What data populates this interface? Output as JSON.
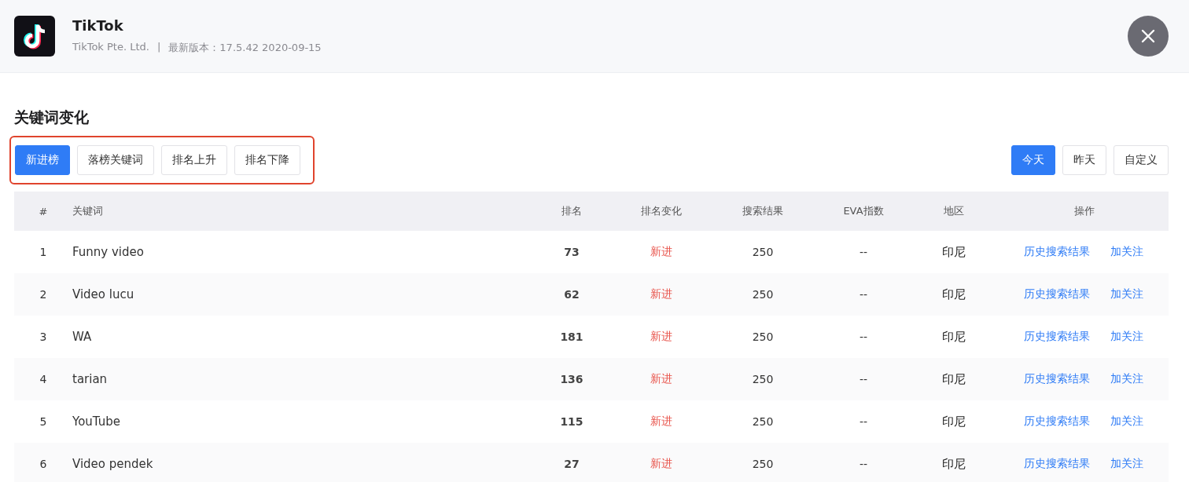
{
  "app": {
    "name": "TikTok",
    "publisher": "TikTok Pte. Ltd.",
    "separator": "|",
    "version": "最新版本：17.5.42 2020-09-15"
  },
  "section_title": "关键词变化",
  "category_tabs": [
    {
      "label": "新进榜",
      "selected": true
    },
    {
      "label": "落榜关键词",
      "selected": false
    },
    {
      "label": "排名上升",
      "selected": false
    },
    {
      "label": "排名下降",
      "selected": false
    }
  ],
  "date_tabs": [
    {
      "label": "今天",
      "selected": true
    },
    {
      "label": "昨天",
      "selected": false
    },
    {
      "label": "自定义",
      "selected": false
    }
  ],
  "table": {
    "columns": [
      "#",
      "关键词",
      "排名",
      "排名变化",
      "搜索结果",
      "EVA指数",
      "地区",
      "操作"
    ],
    "rows": [
      {
        "index": "1",
        "keyword": "Funny video",
        "rank": "73",
        "change": "新进",
        "results": "250",
        "eva": "--",
        "region": "印尼",
        "actions": [
          "历史搜索结果",
          "加关注"
        ]
      },
      {
        "index": "2",
        "keyword": "Video lucu",
        "rank": "62",
        "change": "新进",
        "results": "250",
        "eva": "--",
        "region": "印尼",
        "actions": [
          "历史搜索结果",
          "加关注"
        ]
      },
      {
        "index": "3",
        "keyword": "WA",
        "rank": "181",
        "change": "新进",
        "results": "250",
        "eva": "--",
        "region": "印尼",
        "actions": [
          "历史搜索结果",
          "加关注"
        ]
      },
      {
        "index": "4",
        "keyword": "tarian",
        "rank": "136",
        "change": "新进",
        "results": "250",
        "eva": "--",
        "region": "印尼",
        "actions": [
          "历史搜索结果",
          "加关注"
        ]
      },
      {
        "index": "5",
        "keyword": "YouTube",
        "rank": "115",
        "change": "新进",
        "results": "250",
        "eva": "--",
        "region": "印尼",
        "actions": [
          "历史搜索结果",
          "加关注"
        ]
      },
      {
        "index": "6",
        "keyword": "Video pendek",
        "rank": "27",
        "change": "新进",
        "results": "250",
        "eva": "--",
        "region": "印尼",
        "actions": [
          "历史搜索结果",
          "加关注"
        ]
      }
    ]
  }
}
